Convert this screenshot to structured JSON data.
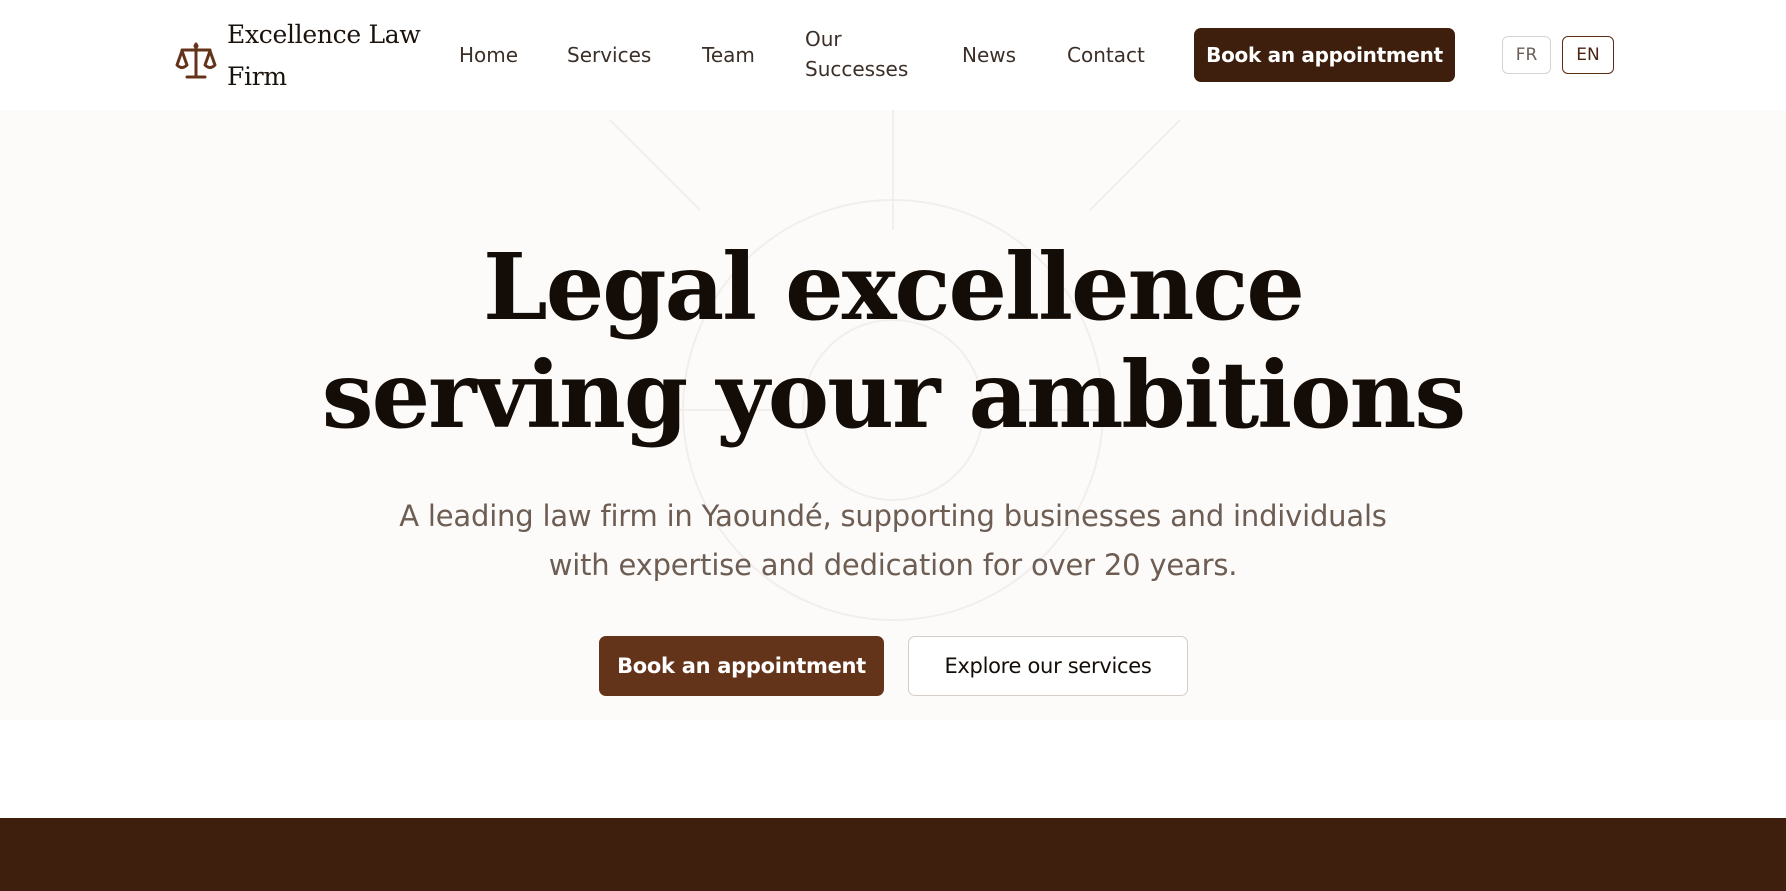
{
  "brand": {
    "name": "Excellence Law Firm",
    "icon": "scales-of-justice-icon",
    "accent_color": "#64341a",
    "dark_color": "#3e1f0d"
  },
  "nav": {
    "items": [
      {
        "label": "Home"
      },
      {
        "label": "Services"
      },
      {
        "label": "Team"
      },
      {
        "label": "Our Successes"
      },
      {
        "label": "News"
      },
      {
        "label": "Contact"
      }
    ],
    "cta_label": "Book an appointment",
    "languages": [
      {
        "code": "FR",
        "selected": false
      },
      {
        "code": "EN",
        "selected": true
      }
    ]
  },
  "hero": {
    "title_line1": "Legal excellence",
    "title_line2": "serving your ambitions",
    "subtitle_line1": "A leading law firm in Yaoundé, supporting businesses and individuals",
    "subtitle_line2": "with expertise and dedication for over 20 years.",
    "primary_button": "Book an appointment",
    "secondary_button": "Explore our services"
  }
}
